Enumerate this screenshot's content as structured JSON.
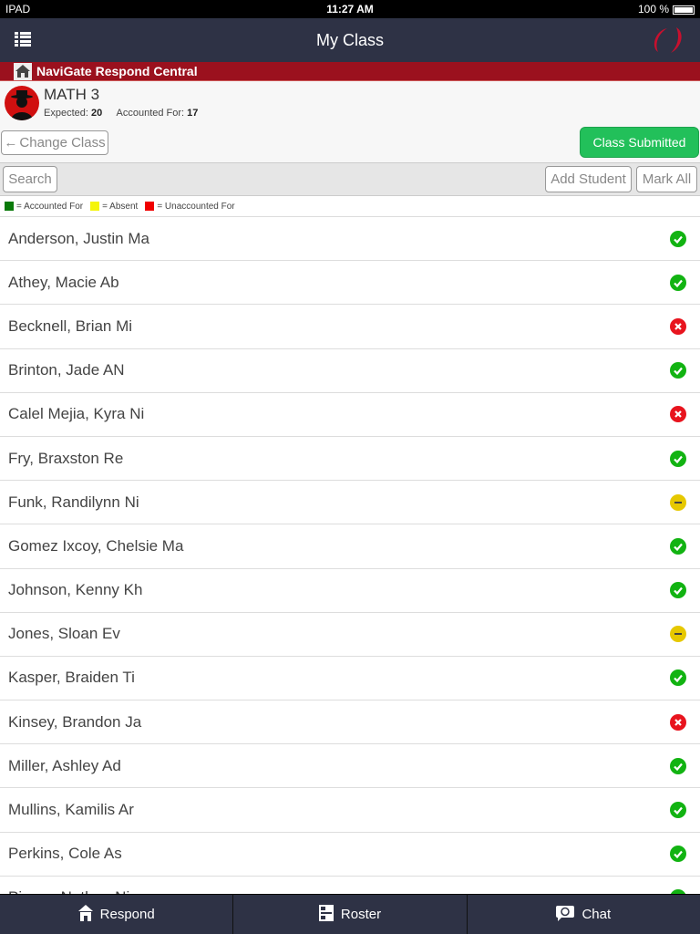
{
  "status_bar": {
    "device": "IPAD",
    "time": "11:27 AM",
    "battery": "100 %"
  },
  "header": {
    "title": "My Class"
  },
  "banner": {
    "title": "NaviGate Respond Central"
  },
  "class_info": {
    "name": "MATH 3",
    "expected_label": "Expected:",
    "expected": "20",
    "accounted_label": "Accounted For:",
    "accounted": "17",
    "change_class": "Change Class",
    "submitted": "Class Submitted"
  },
  "toolbar": {
    "search": "Search",
    "add_student": "Add Student",
    "mark_all": "Mark All"
  },
  "legend": [
    {
      "label": "= Accounted For",
      "color": "#0a7a0a"
    },
    {
      "label": "= Absent",
      "color": "#f5f50a"
    },
    {
      "label": "= Unaccounted For",
      "color": "#f00000"
    }
  ],
  "status_colors": {
    "accounted": "#12b312",
    "absent": "#e6c800",
    "unaccounted": "#e8141e"
  },
  "students": [
    {
      "name": "Anderson, Justin Ma",
      "status": "accounted"
    },
    {
      "name": "Athey, Macie Ab",
      "status": "accounted"
    },
    {
      "name": "Becknell, Brian Mi",
      "status": "unaccounted"
    },
    {
      "name": "Brinton, Jade AN",
      "status": "accounted"
    },
    {
      "name": "Calel Mejia, Kyra Ni",
      "status": "unaccounted"
    },
    {
      "name": "Fry, Braxston Re",
      "status": "accounted"
    },
    {
      "name": "Funk, Randilynn Ni",
      "status": "absent"
    },
    {
      "name": "Gomez Ixcoy, Chelsie Ma",
      "status": "accounted"
    },
    {
      "name": "Johnson, Kenny Kh",
      "status": "accounted"
    },
    {
      "name": "Jones, Sloan Ev",
      "status": "absent"
    },
    {
      "name": "Kasper, Braiden Ti",
      "status": "accounted"
    },
    {
      "name": "Kinsey, Brandon Ja",
      "status": "unaccounted"
    },
    {
      "name": "Miller, Ashley Ad",
      "status": "accounted"
    },
    {
      "name": "Mullins, Kamilis Ar",
      "status": "accounted"
    },
    {
      "name": "Perkins, Cole As",
      "status": "accounted"
    },
    {
      "name": "Pierce, Nathan Ni",
      "status": "accounted"
    }
  ],
  "bottom_nav": [
    {
      "label": "Respond",
      "icon": "house-icon"
    },
    {
      "label": "Roster",
      "icon": "roster-icon"
    },
    {
      "label": "Chat",
      "icon": "chat-icon"
    }
  ]
}
